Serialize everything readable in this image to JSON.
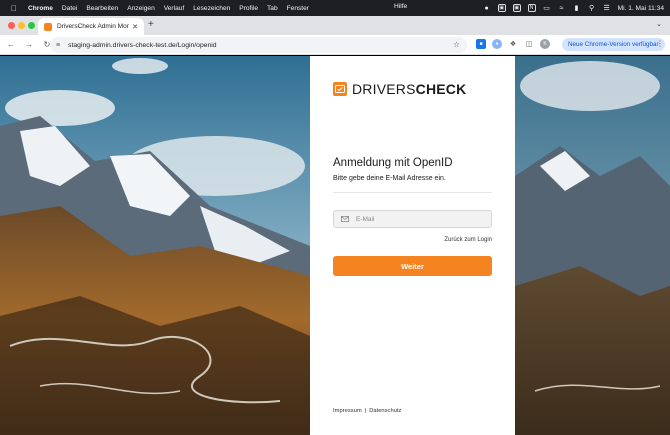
{
  "menubar": {
    "app": "Chrome",
    "items": [
      "Datei",
      "Bearbeiten",
      "Anzeigen",
      "Verlauf",
      "Lesezeichen",
      "Profile",
      "Tab",
      "Fenster"
    ],
    "help": "Hilfe",
    "clock": "Mi. 1. Mai 11:34"
  },
  "browser": {
    "tab_title": "DriversCheck Admin Monitor",
    "url": "staging-admin.drivers-check-test.de/Login/openid",
    "update_button": "Neue Chrome-Version verfügbar",
    "avatar_letter": "K"
  },
  "login": {
    "logo_light": "DRIVERS",
    "logo_bold": "CHECK",
    "heading": "Anmeldung mit OpenID",
    "subheading": "Bitte gebe deine E-Mail Adresse ein.",
    "email_placeholder": "E-Mail",
    "email_value": "",
    "back_link": "Zurück zum Login",
    "submit": "Weiter",
    "footer_impressum": "Impressum",
    "footer_separator": "|",
    "footer_datenschutz": "Datenschutz"
  },
  "colors": {
    "brand_orange": "#f5831f",
    "menubar_bg": "#1e1f22",
    "tabstrip_bg": "#dfe1e5"
  }
}
